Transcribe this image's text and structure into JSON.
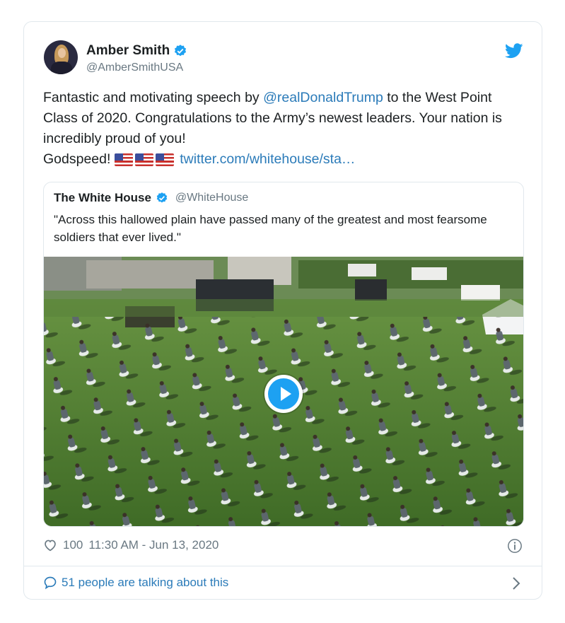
{
  "tweet": {
    "name": "Amber Smith",
    "handle": "@AmberSmithUSA",
    "text_1": "Fantastic and motivating speech by ",
    "mention": "@realDonaldTrump",
    "text_2": " to the West Point Class of 2020. Congratulations to the Army’s newest leaders. Your nation is incredibly proud of you!",
    "text_3": "Godspeed! ",
    "link": "twitter.com/whitehouse/sta…",
    "likes": "100",
    "timestamp": "11:30 AM - Jun 13, 2020",
    "talking": "51 people are talking about this"
  },
  "quote": {
    "name": "The White House",
    "handle": "@WhiteHouse",
    "text": "\"Across this hallowed plain have passed many of the greatest and most fearsome soldiers that ever lived.\""
  },
  "colors": {
    "link": "#2b7bb9",
    "verified": "#1da1f2",
    "muted": "#697882",
    "border": "#e1e8ed"
  },
  "icons": [
    "twitter-bird-icon",
    "verified-badge-icon",
    "us-flag-icon",
    "play-icon",
    "heart-icon",
    "info-icon",
    "comment-bubble-icon",
    "chevron-right-icon"
  ]
}
